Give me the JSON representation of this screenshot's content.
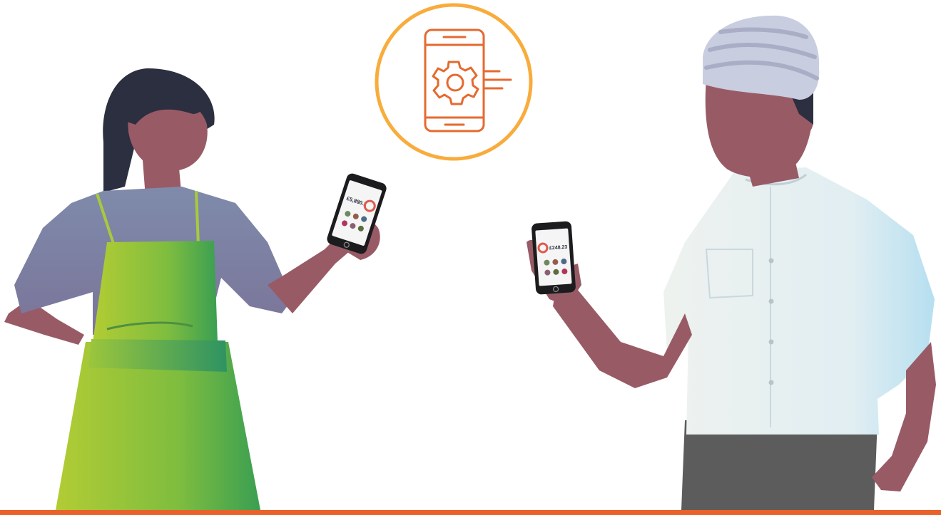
{
  "illustration": {
    "badge_icon": "mobile-settings-icon",
    "woman_phone": {
      "balance": "£5,880.2"
    },
    "man_phone": {
      "balance": "£248.23"
    }
  },
  "colors": {
    "badge_ring": "#f8ac3c",
    "badge_icon_stroke": "#e56a2f",
    "bottom_rule": "#e8622a",
    "skin": "#985b66",
    "hair": "#2c2f40",
    "woman_sleeve": "#7e87a6",
    "apron_light": "#a7c93a",
    "apron_dark": "#3a9f52",
    "man_shirt": "#e4edf1",
    "man_turban": "#c9cde0",
    "man_trousers": "#5c5c5c",
    "phone_body": "#1c1c1e"
  }
}
